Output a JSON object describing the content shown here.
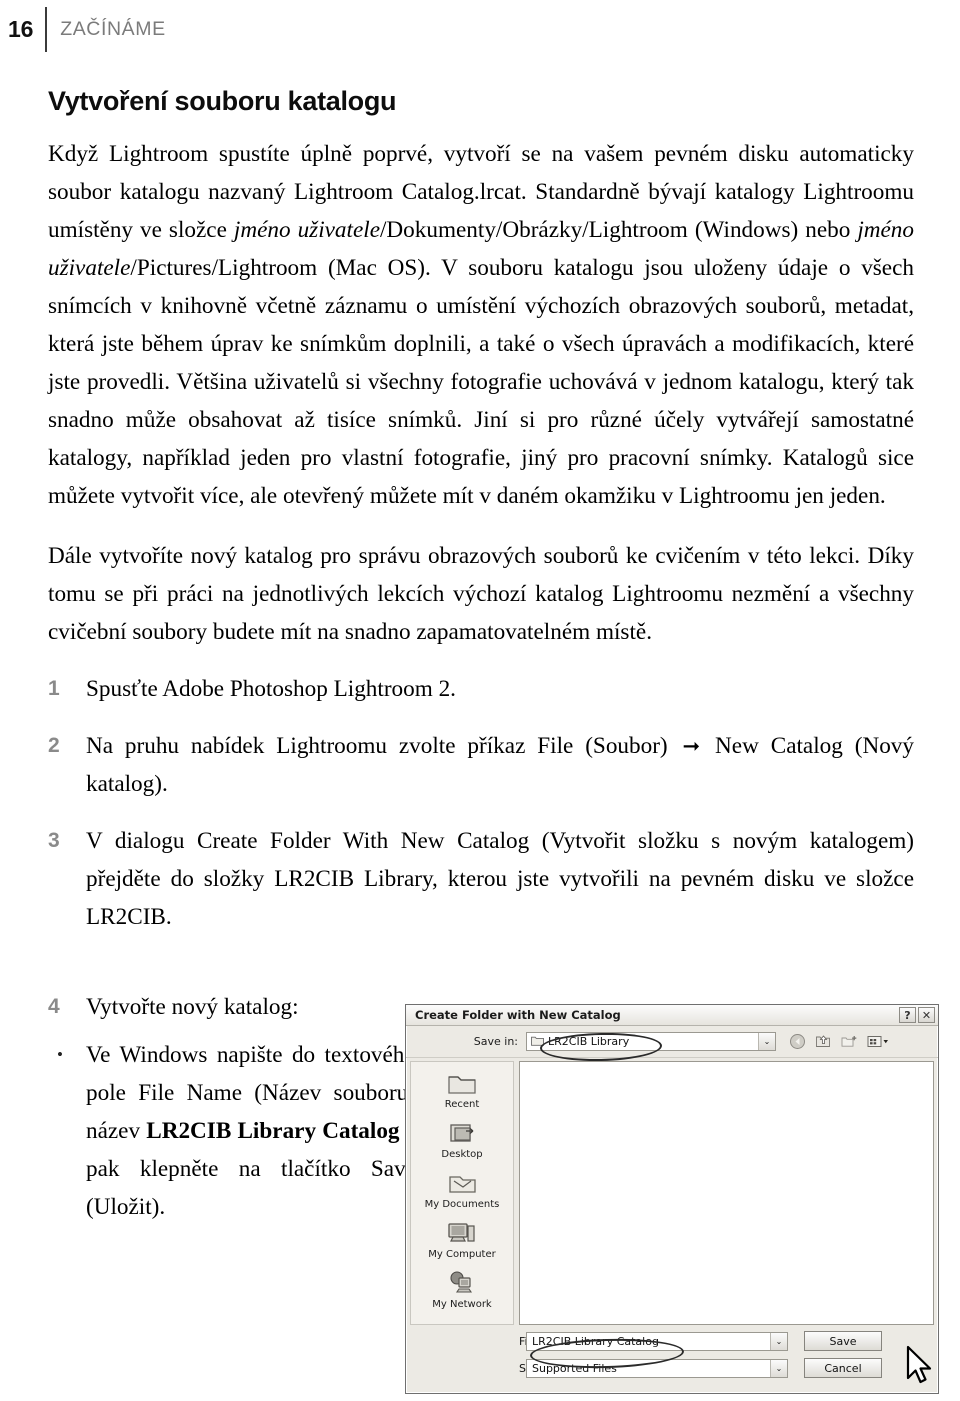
{
  "header": {
    "folio": "16",
    "running_title": "ZAČÍNÁME"
  },
  "section": {
    "title": "Vytvoření souboru katalogu"
  },
  "paragraphs": {
    "p1_a": "Když Lightroom spustíte úplně poprvé, vytvoří se na vašem pevném disku automaticky soubor katalogu nazvaný Lightroom Catalog.lrcat. Standardně bývají katalogy Lightroomu umístěny ve složce ",
    "p1_it1": "jméno uživatele",
    "p1_b": "/Dokumenty/Obrázky/Lightroom (Windows) nebo ",
    "p1_it2": "jméno uživatele",
    "p1_c": "/Pictures/Lightroom (Mac OS). V souboru katalogu jsou uloženy údaje o všech snímcích v knihovně včetně záznamu o umístění výchozích obrazových souborů, metadat, která jste během úprav ke snímkům doplnili, a také o všech úpravách a modifikacích, které jste provedli. Většina uživatelů si všechny fotografie uchovává v jednom katalogu, který tak snadno může obsahovat až tisíce snímků. Jiní si pro různé účely vytvářejí samostatné katalogy, například jeden pro vlastní fotografie, jiný pro pracovní snímky. Katalogů sice můžete vytvořit více, ale otevřený můžete mít v daném okamžiku v Lightroomu jen jeden.",
    "p2": "Dále vytvoříte nový katalog pro správu obrazových souborů ke cvičením v této lekci. Díky tomu se při práci na jednotlivých lekcích výchozí katalog Lightroomu nezmění a všechny cvičební soubory budete mít na snadno zapamatovatelném místě."
  },
  "steps": [
    {
      "number": "1",
      "text": "Spusťte Adobe Photoshop Lightroom 2."
    },
    {
      "number": "2",
      "text_before": "Na pruhu nabídek Lightroomu zvolte příkaz File (Soubor) ",
      "arrow": "➞",
      "text_after": " New Catalog (Nový katalog)."
    },
    {
      "number": "3",
      "text": "V dialogu Create Folder With New Catalog (Vytvořit složku s novým katalogem) přejděte do složky LR2CIB Library, kterou jste vytvořili na pevném disku ve složce LR2CIB."
    },
    {
      "number": "4",
      "text": "Vytvořte nový katalog:"
    }
  ],
  "bullet": {
    "marker": "•",
    "text_before": "Ve Windows napište do textového pole File Name (Název souboru) název ",
    "bold_text": "LR2CIB Library Catalog",
    "text_after": " a pak klepněte na tlačítko Save (Uložit)."
  },
  "dialog": {
    "title": "Create Folder with New Catalog",
    "help_button": "?",
    "close_button": "✕",
    "save_in_label": "Save in:",
    "save_in_value": "LR2CIB Library",
    "dropdown_arrow": "⌄",
    "toolbar_icons": [
      "back-navigation-icon",
      "up-one-level-icon",
      "create-new-folder-icon",
      "views-menu-icon"
    ],
    "places": [
      {
        "label": "Recent",
        "icon": "recent-folder-icon"
      },
      {
        "label": "Desktop",
        "icon": "desktop-icon"
      },
      {
        "label": "My Documents",
        "icon": "my-documents-icon"
      },
      {
        "label": "My Computer",
        "icon": "my-computer-icon"
      },
      {
        "label": "My Network",
        "icon": "my-network-icon"
      }
    ],
    "file_name_label": "File name:",
    "file_name_value": "LR2CIB Library Catalog",
    "save_as_type_label": "Save as type:",
    "save_as_type_value": "Supported Files",
    "save_button": "Save",
    "cancel_button": "Cancel"
  }
}
